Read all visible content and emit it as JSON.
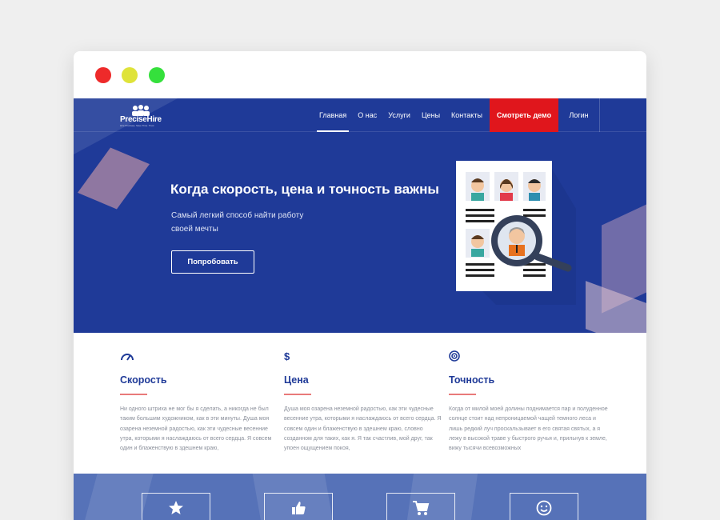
{
  "brand": {
    "name": "PreciseHire",
    "tagline": "Hire Precisely. Save Time. Trust"
  },
  "nav": {
    "links": [
      "Главная",
      "О нас",
      "Услуги",
      "Цены",
      "Контакты"
    ],
    "demo_label": "Смотреть демо",
    "login_label": "Логин"
  },
  "hero": {
    "title": "Когда скорость, цена и точность важны",
    "subtitle": "Самый легкий способ найти работу своей мечты",
    "cta_label": "Попробовать"
  },
  "features": [
    {
      "icon": "speedometer-icon",
      "title": "Скорость",
      "text": "Ни одного штриха не мог бы я сделать, а никогда не был таким большим художником, как в эти минуты. Душа моя озарена неземной радостью, как эти чудесные весенние утра, которыми я наслаждаюсь от всего сердца. Я совсем один и блаженствую в здешнем краю,"
    },
    {
      "icon": "dollar-icon",
      "title": "Цена",
      "text": "Душа моя озарена неземной радостью, как эти чудесные весенние утра, которыми я наслаждаюсь от всего сердца. Я совсем один и блаженствую в здешнем краю, словно созданном для таких, как я. Я так счастлив, мой друг, так упоен ощущением покоя,"
    },
    {
      "icon": "target-icon",
      "title": "Точность",
      "text": "Когда от милой моей долины поднимается пар и полуденное солнце стоит над непроницаемой чащей темного леса и лишь редкий луч проскальзывает в его святая святых, а я лежу в высокой траве у быстрого ручья и, прильнув к земле, вижу тысячи всевозможных"
    }
  ],
  "bottom_tiles": [
    "star-icon",
    "thumbs-up-icon",
    "cart-icon",
    "smiley-icon"
  ],
  "colors": {
    "primary": "#1f3a98",
    "accent": "#e0161c",
    "underline": "#e97a7a"
  }
}
